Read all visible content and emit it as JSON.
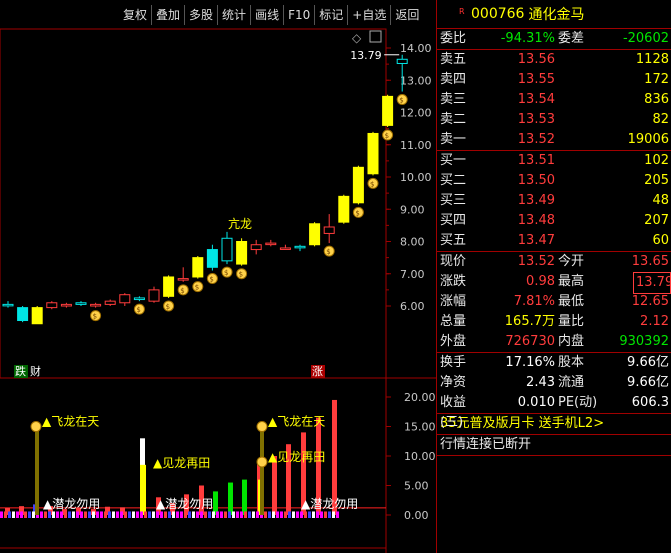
{
  "toolbar": [
    "复权",
    "叠加",
    "多股",
    "统计",
    "画线",
    "F10",
    "标记",
    "+自选",
    "返回"
  ],
  "stock": {
    "badge": "R",
    "code": "000766",
    "name": "通化金马"
  },
  "weibi": {
    "label": "委比",
    "value": "-94.31%",
    "label2": "委差",
    "value2": "-20602"
  },
  "asks": [
    {
      "label": "卖五",
      "price": "13.56",
      "vol": "1128"
    },
    {
      "label": "卖四",
      "price": "13.55",
      "vol": "172"
    },
    {
      "label": "卖三",
      "price": "13.54",
      "vol": "836"
    },
    {
      "label": "卖二",
      "price": "13.53",
      "vol": "82"
    },
    {
      "label": "卖一",
      "price": "13.52",
      "vol": "19006"
    }
  ],
  "bids": [
    {
      "label": "买一",
      "price": "13.51",
      "vol": "102"
    },
    {
      "label": "买二",
      "price": "13.50",
      "vol": "205"
    },
    {
      "label": "买三",
      "price": "13.49",
      "vol": "48"
    },
    {
      "label": "买四",
      "price": "13.48",
      "vol": "207"
    },
    {
      "label": "买五",
      "price": "13.47",
      "vol": "60"
    }
  ],
  "quote": [
    {
      "l1": "现价",
      "v1": "13.52",
      "l2": "今开",
      "v2": "13.65"
    },
    {
      "l1": "涨跌",
      "v1": "0.98",
      "l2": "最高",
      "v2": "13.79"
    },
    {
      "l1": "涨幅",
      "v1": "7.81%",
      "l2": "最低",
      "v2": "12.65"
    },
    {
      "l1": "总量",
      "v1": "165.7万",
      "l2": "量比",
      "v2": "2.12"
    },
    {
      "l1": "外盘",
      "v1": "726730",
      "l2": "内盘",
      "v2": "930392"
    }
  ],
  "stats": [
    {
      "l1": "换手",
      "v1": "17.16%",
      "l2": "股本",
      "v2": "9.66亿"
    },
    {
      "l1": "净资",
      "v1": "2.43",
      "l2": "流通",
      "v2": "9.66亿"
    },
    {
      "l1": "收益(三)",
      "v1": "0.010",
      "l2": "PE(动)",
      "v2": "606.3"
    }
  ],
  "promo": "35元普及版月卡 送手机L2>",
  "status": "行情连接已断开",
  "chart_data": [
    {
      "type": "candlestick",
      "high_label": "13.79",
      "yticks": [
        "14.00",
        "13.00",
        "12.00",
        "11.00",
        "10.00",
        "9.00",
        "8.00",
        "7.00",
        "6.00"
      ],
      "ylim": [
        5.3,
        14.5
      ],
      "candles": [
        {
          "o": 6.05,
          "c": 6.05,
          "h": 6.15,
          "l": 5.95,
          "color": "#00e6e6"
        },
        {
          "o": 5.95,
          "c": 5.55,
          "h": 6.0,
          "l": 5.5,
          "color": "#00e6e6",
          "fill": true
        },
        {
          "o": 5.95,
          "c": 5.45,
          "h": 6.0,
          "l": 5.45,
          "color": "#ffff00",
          "fill": true
        },
        {
          "o": 5.95,
          "c": 6.1,
          "h": 6.15,
          "l": 5.9,
          "color": "#ff3c3c"
        },
        {
          "o": 6.0,
          "c": 6.05,
          "h": 6.1,
          "l": 5.95,
          "color": "#ff3c3c"
        },
        {
          "o": 6.05,
          "c": 6.1,
          "h": 6.15,
          "l": 6.0,
          "color": "#00e6e6"
        },
        {
          "o": 6.0,
          "c": 6.05,
          "h": 6.1,
          "l": 5.95,
          "color": "#ff3c3c"
        },
        {
          "o": 6.05,
          "c": 6.15,
          "h": 6.2,
          "l": 6.0,
          "color": "#ff3c3c"
        },
        {
          "o": 6.1,
          "c": 6.35,
          "h": 6.4,
          "l": 6.0,
          "color": "#ff3c3c"
        },
        {
          "o": 6.25,
          "c": 6.2,
          "h": 6.3,
          "l": 6.15,
          "color": "#00e6e6"
        },
        {
          "o": 6.15,
          "c": 6.5,
          "h": 6.6,
          "l": 6.1,
          "color": "#ff3c3c"
        },
        {
          "o": 6.3,
          "c": 6.9,
          "h": 6.95,
          "l": 6.25,
          "color": "#ffff00",
          "fill": true
        },
        {
          "o": 6.85,
          "c": 6.85,
          "h": 7.2,
          "l": 6.75,
          "color": "#ff3c3c"
        },
        {
          "o": 6.9,
          "c": 7.5,
          "h": 7.55,
          "l": 6.85,
          "color": "#ffff00",
          "fill": true
        },
        {
          "o": 7.2,
          "c": 7.75,
          "h": 7.9,
          "l": 7.1,
          "color": "#00e6e6",
          "fill": true
        },
        {
          "o": 7.4,
          "c": 8.1,
          "h": 8.3,
          "l": 7.3,
          "color": "#00e6e6"
        },
        {
          "o": 7.3,
          "c": 8.0,
          "h": 8.1,
          "l": 7.25,
          "color": "#ffff00",
          "fill": true
        },
        {
          "o": 7.75,
          "c": 7.9,
          "h": 8.05,
          "l": 7.6,
          "color": "#ff3c3c"
        },
        {
          "o": 7.95,
          "c": 7.95,
          "h": 8.05,
          "l": 7.85,
          "color": "#ff3c3c"
        },
        {
          "o": 7.8,
          "c": 7.8,
          "h": 7.9,
          "l": 7.75,
          "color": "#ff3c3c"
        },
        {
          "o": 7.85,
          "c": 7.85,
          "h": 7.9,
          "l": 7.7,
          "color": "#00e6e6"
        },
        {
          "o": 7.9,
          "c": 8.55,
          "h": 8.6,
          "l": 7.85,
          "color": "#ffff00",
          "fill": true
        },
        {
          "o": 8.25,
          "c": 8.45,
          "h": 8.85,
          "l": 7.95,
          "color": "#ff3c3c"
        },
        {
          "o": 8.6,
          "c": 9.4,
          "h": 9.45,
          "l": 8.55,
          "color": "#ffff00",
          "fill": true
        },
        {
          "o": 9.2,
          "c": 10.3,
          "h": 10.35,
          "l": 9.15,
          "color": "#ffff00",
          "fill": true
        },
        {
          "o": 10.1,
          "c": 11.35,
          "h": 11.4,
          "l": 10.05,
          "color": "#ffff00",
          "fill": true
        },
        {
          "o": 11.6,
          "c": 12.5,
          "h": 12.55,
          "l": 11.55,
          "color": "#ffff00",
          "fill": true
        },
        {
          "o": 13.65,
          "c": 13.52,
          "h": 13.79,
          "l": 12.65,
          "color": "#00e6e6"
        }
      ],
      "labels": {
        "bottom_left": "跌",
        "bottom_left2": "财",
        "bottom_right": "涨",
        "annotation": "亢龙"
      }
    },
    {
      "type": "bar",
      "yticks": [
        "20.00",
        "15.00",
        "10.00",
        "5.00",
        "0.00"
      ],
      "ylim": [
        -1,
        21
      ],
      "annotations": [
        "飞龙在天",
        "见龙再田",
        "潜龙勿用",
        "潜龙勿用",
        "飞龙在天",
        "见龙再田",
        "潜龙勿用"
      ]
    }
  ]
}
